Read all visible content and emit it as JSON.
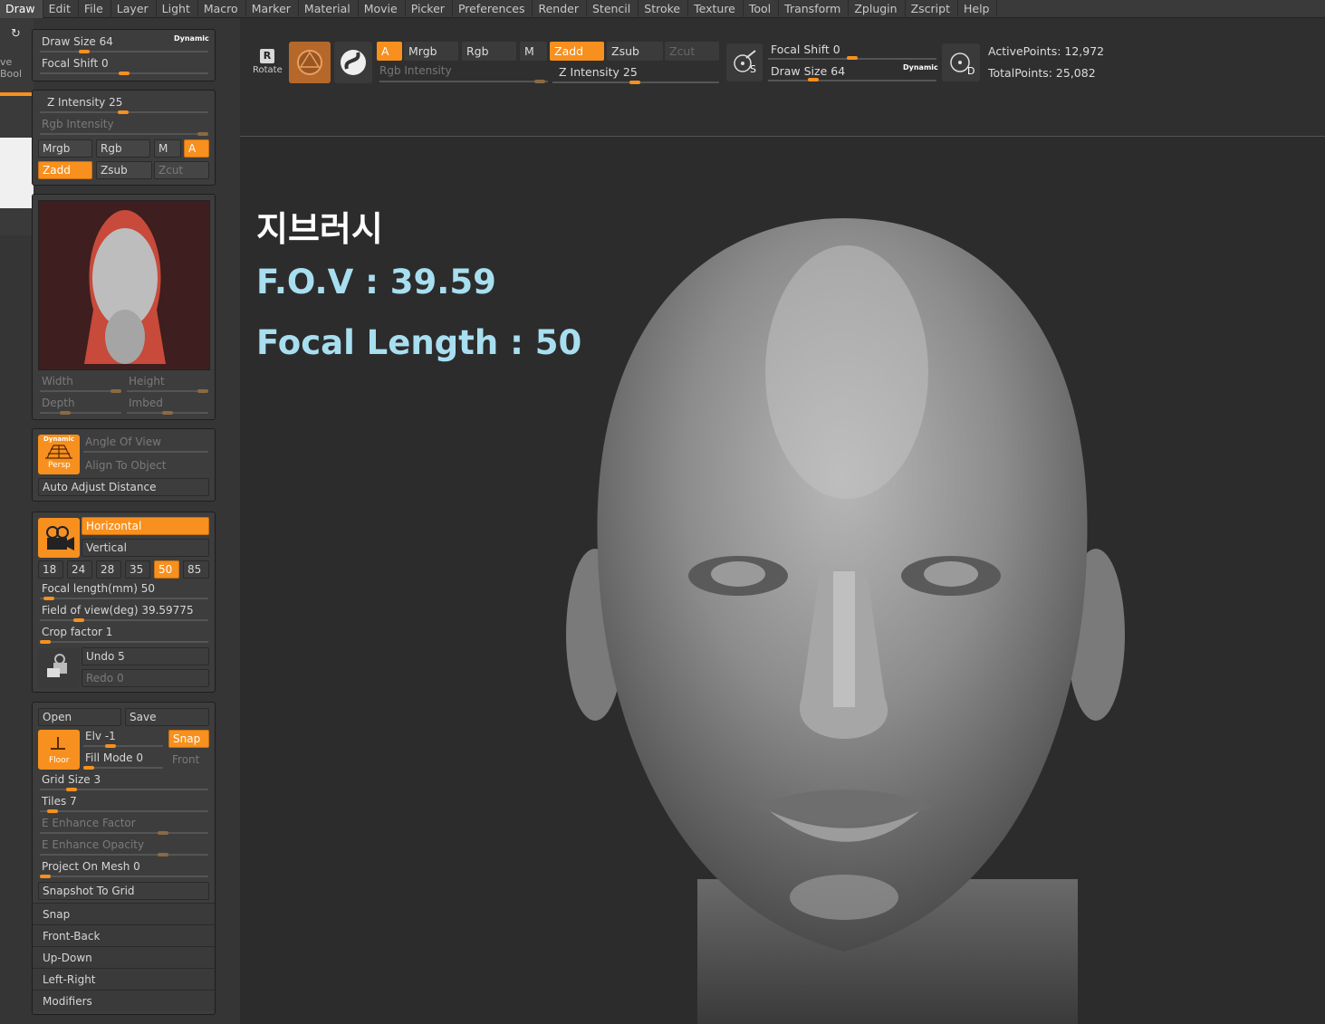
{
  "menu": [
    "Draw",
    "Edit",
    "File",
    "Layer",
    "Light",
    "Macro",
    "Marker",
    "Material",
    "Movie",
    "Picker",
    "Preferences",
    "Render",
    "Stencil",
    "Stroke",
    "Texture",
    "Tool",
    "Transform",
    "Zplugin",
    "Zscript",
    "Help"
  ],
  "shelf": {
    "rotate": "Rotate",
    "scale_partial": "cale",
    "bool_partial": "ve Bool",
    "a": "A",
    "mrgb": "Mrgb",
    "rgb": "Rgb",
    "m": "M",
    "zadd": "Zadd",
    "zsub": "Zsub",
    "zcut": "Zcut",
    "rgb_intensity": "Rgb Intensity",
    "z_intensity": "Z Intensity 25",
    "focal_shift": "Focal Shift 0",
    "draw_size": "Draw Size 64",
    "dynamic": "Dynamic",
    "s_badge": "S",
    "d_badge": "D",
    "active_points": "ActivePoints: 12,972",
    "total_points": "TotalPoints: 25,082"
  },
  "brush_panel": {
    "draw_size": "Draw Size 64",
    "dynamic": "Dynamic",
    "focal_shift": "Focal Shift 0"
  },
  "intensity_panel": {
    "z_intensity": "Z Intensity 25",
    "rgb_intensity": "Rgb Intensity",
    "mrgb": "Mrgb",
    "rgb": "Rgb",
    "m": "M",
    "a": "A",
    "zadd": "Zadd",
    "zsub": "Zsub",
    "zcut": "Zcut"
  },
  "thumb_panel": {
    "width": "Width",
    "height": "Height",
    "depth": "Depth",
    "imbed": "Imbed"
  },
  "persp_panel": {
    "dynamic": "Dynamic",
    "persp": "Persp",
    "angle_of_view": "Angle Of View",
    "align_to_object": "Align To Object",
    "auto_adjust": "Auto Adjust Distance"
  },
  "camera_panel": {
    "horizontal": "Horizontal",
    "vertical": "Vertical",
    "lenses": [
      "18",
      "24",
      "28",
      "35",
      "50",
      "85"
    ],
    "active_lens": "50",
    "focal_length": "Focal length(mm) 50",
    "fov": "Field of view(deg) 39.59775",
    "crop": "Crop factor 1",
    "undo": "Undo 5",
    "redo": "Redo 0"
  },
  "floor_panel": {
    "open": "Open",
    "save": "Save",
    "floor": "Floor",
    "elv": "Elv -1",
    "snap": "Snap",
    "fill_mode": "Fill Mode 0",
    "front": "Front",
    "grid_size": "Grid Size 3",
    "tiles": "Tiles 7",
    "e_enhance_factor": "E Enhance Factor",
    "e_enhance_opacity": "E Enhance Opacity",
    "project_on_mesh": "Project On Mesh 0",
    "snapshot_to_grid": "Snapshot To Grid",
    "rows": [
      "Snap",
      "Front-Back",
      "Up-Down",
      "Left-Right",
      "Modifiers"
    ]
  },
  "overlay": {
    "title": "지브러시",
    "fov": "F.O.V : 39.59",
    "focal": "Focal Length : 50"
  },
  "colors": {
    "accent": "#f7901e",
    "overlay_text": "#a8dff0"
  }
}
